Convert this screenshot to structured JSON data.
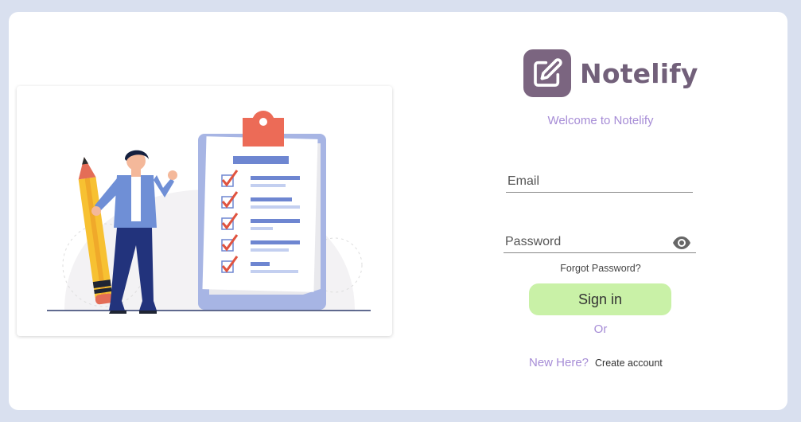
{
  "app": {
    "name": "Notelify",
    "logo_icon": "edit-note-icon",
    "brand_color": "#72607a",
    "logo_bg": "#7b6580"
  },
  "login": {
    "welcome": "Welcome to Notelify",
    "email": {
      "placeholder": "Email",
      "value": ""
    },
    "password": {
      "placeholder": "Password",
      "value": "",
      "toggle_icon": "eye-icon"
    },
    "forgot_label": "Forgot Password?",
    "signin_label": "Sign in",
    "or_label": "Or",
    "new_here_label": "New Here?",
    "create_label": "Create account",
    "accent_color": "#a68cd6",
    "button_color": "#c9f1a7"
  },
  "illustration": {
    "icon": "checklist-person-illustration",
    "checklist_items": 5
  }
}
